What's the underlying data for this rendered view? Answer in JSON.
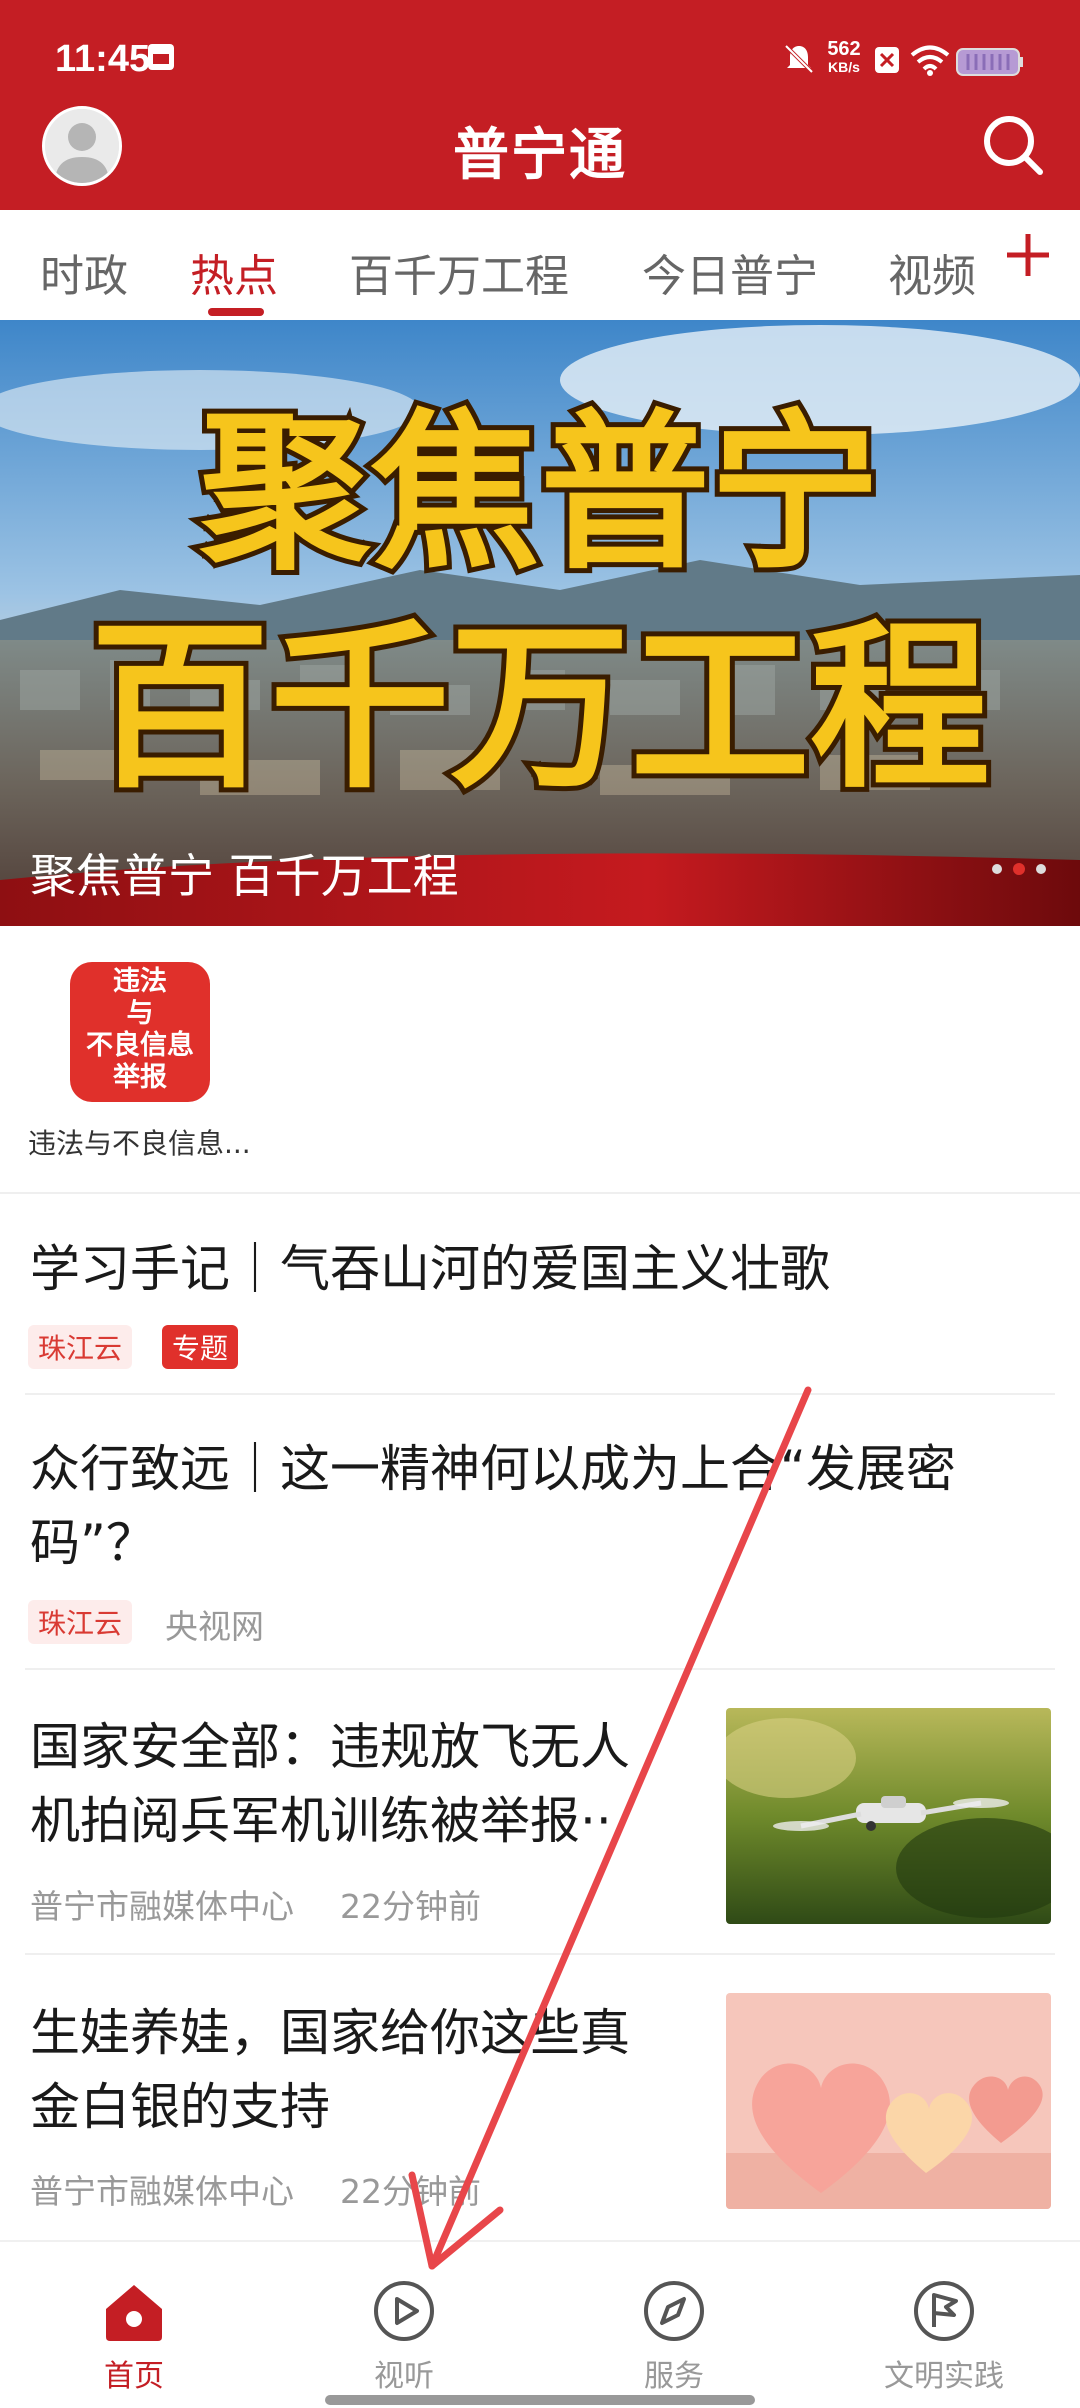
{
  "status_bar": {
    "time": "11:45",
    "network_speed_value": "562",
    "network_speed_unit": "KB/s"
  },
  "header": {
    "title": "普宁通"
  },
  "tabs": [
    {
      "label": "时政"
    },
    {
      "label": "热点"
    },
    {
      "label": "百千万工程"
    },
    {
      "label": "今日普宁"
    },
    {
      "label": "视频"
    }
  ],
  "banner": {
    "image_text_line1": "聚焦普宁",
    "image_text_line2": "百千万工程",
    "caption": "聚焦普宁 百千万工程"
  },
  "services": [
    {
      "icon_text": [
        "违法",
        "与",
        "不良信息",
        "举报"
      ],
      "label": "违法与不良信息..."
    }
  ],
  "articles": [
    {
      "title": "学习手记｜气吞山河的爱国主义壮歌",
      "tags": [
        "珠江云",
        "专题"
      ]
    },
    {
      "title_line1": "众行致远｜这一精神何以成为上合“发展密",
      "title_line2": "码”？",
      "tag": "珠江云",
      "source": "央视网"
    },
    {
      "title_line1": "国家安全部：违规放飞无人",
      "title_line2": "机拍阅兵军机训练被举报··",
      "source": "普宁市融媒体中心",
      "time": "22分钟前",
      "thumb_icon": "drone-photo"
    },
    {
      "title_line1": "生娃养娃，国家给你这些真",
      "title_line2": "金白银的支持",
      "source": "普宁市融媒体中心",
      "time": "22分钟前",
      "thumb_icon": "hearts-photo"
    }
  ],
  "bottom_nav": [
    {
      "label": "首页",
      "icon": "home-icon"
    },
    {
      "label": "视听",
      "icon": "play-icon"
    },
    {
      "label": "服务",
      "icon": "compass-icon"
    },
    {
      "label": "文明实践",
      "icon": "flag-icon"
    }
  ],
  "colors": {
    "brand": "#c41e24",
    "inactive": "#999999"
  }
}
